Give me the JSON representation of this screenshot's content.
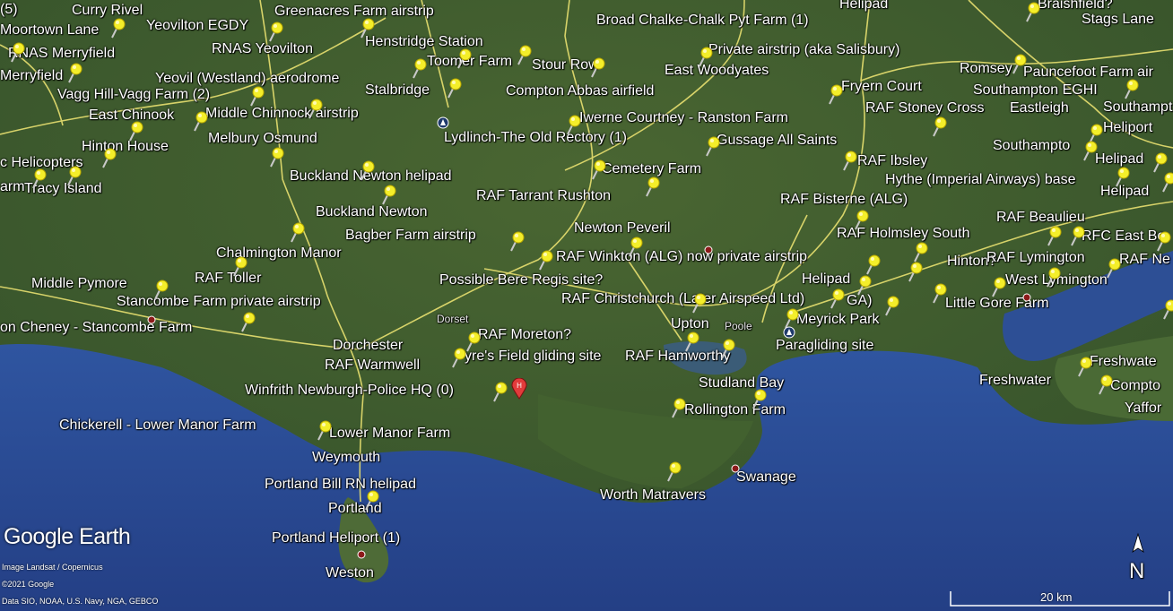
{
  "places": [
    {
      "name": "(5)"
    },
    {
      "name": "Curry Rivel"
    },
    {
      "name": "Yeovilton EGDY"
    },
    {
      "name": "Greenacres Farm airstrip"
    },
    {
      "name": "Broad Chalke-Chalk Pyt Farm  (1)"
    },
    {
      "name": "Helipad"
    },
    {
      "name": "Braishfield?"
    },
    {
      "name": "Stags Lane"
    },
    {
      "name": "Moortown Lane"
    },
    {
      "name": "RNAS Merryfield"
    },
    {
      "name": "RNAS Yeovilton"
    },
    {
      "name": "Henstridge Station"
    },
    {
      "name": "Toomer Farm"
    },
    {
      "name": "Stour Row"
    },
    {
      "name": "Private airstrip (aka Salisbury)"
    },
    {
      "name": "Merryfield"
    },
    {
      "name": "Yeovil (Westland) aerodrome"
    },
    {
      "name": "East Woodyates"
    },
    {
      "name": "Romsey"
    },
    {
      "name": "Pauncefoot Farm air"
    },
    {
      "name": "Vagg Hill-Vagg Farm (2)"
    },
    {
      "name": "Stalbridge"
    },
    {
      "name": "Compton Abbas airfield"
    },
    {
      "name": "Fryern Court"
    },
    {
      "name": "Southampton EGHI"
    },
    {
      "name": "East Chinook"
    },
    {
      "name": "Middle Chinnock airstrip"
    },
    {
      "name": "Iwerne Courtney - Ranston Farm"
    },
    {
      "name": "RAF Stoney Cross"
    },
    {
      "name": "Eastleigh"
    },
    {
      "name": "Southampt"
    },
    {
      "name": "Melbury Osmund"
    },
    {
      "name": "Lydlinch-The Old Rectory (1)"
    },
    {
      "name": "Heliport"
    },
    {
      "name": "Hinton House"
    },
    {
      "name": "Gussage All Saints"
    },
    {
      "name": "Southampto"
    },
    {
      "name": "c Helicopters"
    },
    {
      "name": "RAF Ibsley"
    },
    {
      "name": "Helipad"
    },
    {
      "name": "Cemetery Farm"
    },
    {
      "name": "Buckland Newton helipad"
    },
    {
      "name": "Hythe (Imperial Airways) base"
    },
    {
      "name": "arm"
    },
    {
      "name": "Tracy Island"
    },
    {
      "name": "Helipad"
    },
    {
      "name": "RAF Tarrant Rushton"
    },
    {
      "name": "RAF Bisterne (ALG)"
    },
    {
      "name": "Buckland Newton"
    },
    {
      "name": "RAF Beaulieu"
    },
    {
      "name": "Newton Peveril"
    },
    {
      "name": "Bagber Farm airstrip"
    },
    {
      "name": "RAF Holmsley South"
    },
    {
      "name": "RFC East Bo"
    },
    {
      "name": "Chalmington Manor"
    },
    {
      "name": "RAF Winkton (ALG) now private airstrip"
    },
    {
      "name": "Hinton?"
    },
    {
      "name": "RAF Lymington"
    },
    {
      "name": "RAF Ne"
    },
    {
      "name": "RAF Toller"
    },
    {
      "name": "Helipad"
    },
    {
      "name": "Middle Pymore"
    },
    {
      "name": "Possible Bere Regis site?"
    },
    {
      "name": "West Lymington"
    },
    {
      "name": "Stancombe Farm private airstrip"
    },
    {
      "name": "RAF Christchurch (Later Airspeed Ltd)"
    },
    {
      "name": "GA)"
    },
    {
      "name": "Little Gore Farm"
    },
    {
      "name": "Dorset"
    },
    {
      "name": "Meyrick Park"
    },
    {
      "name": "on Cheney - Stancombe Farm"
    },
    {
      "name": "Upton"
    },
    {
      "name": "Poole"
    },
    {
      "name": "RAF Moreton?"
    },
    {
      "name": "Dorchester"
    },
    {
      "name": "Paragliding site"
    },
    {
      "name": "RAF Warmwell"
    },
    {
      "name": "yre's Field gliding site"
    },
    {
      "name": "RAF Hamworthy"
    },
    {
      "name": "Freshwate"
    },
    {
      "name": "Winfrith Newburgh-Police HQ (0)"
    },
    {
      "name": "Studland Bay"
    },
    {
      "name": "Freshwater"
    },
    {
      "name": "Compto"
    },
    {
      "name": "Rollington Farm"
    },
    {
      "name": "Yaffor"
    },
    {
      "name": "Chickerell - Lower Manor Farm"
    },
    {
      "name": "Lower Manor Farm"
    },
    {
      "name": "Weymouth"
    },
    {
      "name": "Swanage"
    },
    {
      "name": "Portland Bill RN helipad"
    },
    {
      "name": "Worth Matravers"
    },
    {
      "name": "Portland"
    },
    {
      "name": "Portland Heliport (1)"
    },
    {
      "name": "Weston"
    }
  ],
  "branding": {
    "logo": "Google Earth",
    "credit1": "Image Landsat / Copernicus",
    "credit2": "©2021 Google",
    "credit3": "Data SIO, NOAA, U.S. Navy, NGA, GEBCO"
  },
  "scale_bar": {
    "label": "20 km"
  },
  "compass": {
    "label": "N"
  },
  "colors": {
    "land": "#3d5a2a",
    "sea": "#2a4a8c",
    "roads": "#e8e070",
    "pin": "#f4ee2a"
  }
}
